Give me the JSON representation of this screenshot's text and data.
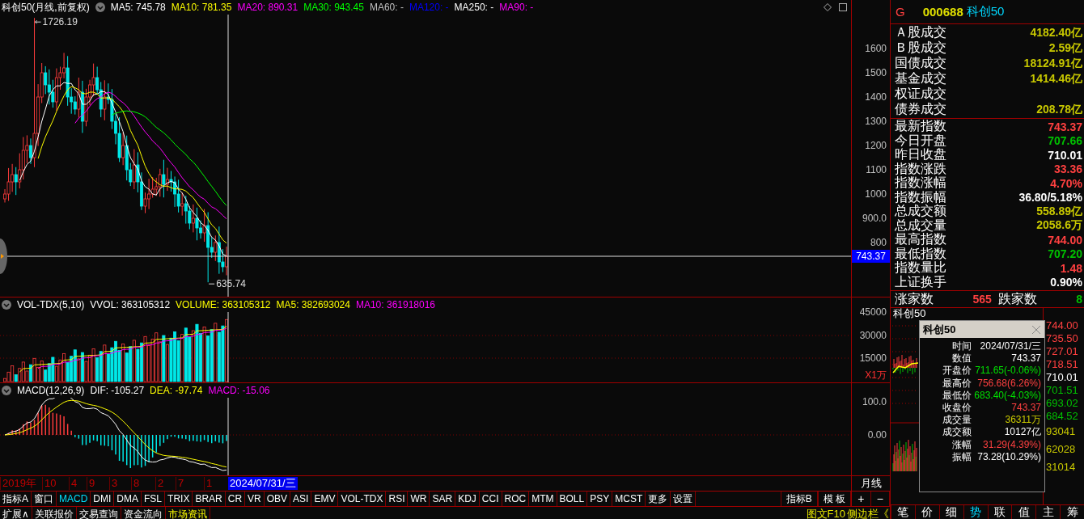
{
  "main_header": {
    "title": "科创50(月线,前复权)",
    "indicators": [
      {
        "label": "MA5: 745.78",
        "color": "#ffffff"
      },
      {
        "label": "MA10: 781.35",
        "color": "#ffff00"
      },
      {
        "label": "MA20: 890.31",
        "color": "#ff00ff"
      },
      {
        "label": "MA30: 943.45",
        "color": "#00ff00"
      },
      {
        "label": "MA60: -",
        "color": "#c0c0c0"
      },
      {
        "label": "MA120: -",
        "color": "#0000ff"
      },
      {
        "label": "MA250: -",
        "color": "#ffffff"
      },
      {
        "label": "MA90: -",
        "color": "#ff00ff"
      }
    ]
  },
  "price_axis": {
    "ticks": [
      "1600",
      "1500",
      "1400",
      "1300",
      "1200",
      "1100",
      "1000",
      "900.0",
      "800"
    ],
    "current": "743.37"
  },
  "price_marks": {
    "high": "1726.19",
    "low": "635.74"
  },
  "volume_panel": {
    "title": "VOL-TDX(5,10)",
    "indicators": [
      {
        "label": "VVOL: 363105312",
        "color": "#ffffff"
      },
      {
        "label": "VOLUME: 363105312",
        "color": "#ffff00"
      },
      {
        "label": "MA5: 382693024",
        "color": "#ffff00"
      },
      {
        "label": "MA10: 361918016",
        "color": "#ff00ff"
      }
    ],
    "ticks": [
      "45000",
      "30000",
      "15000"
    ],
    "unit": "X1万"
  },
  "macd_panel": {
    "title": "MACD(12,26,9)",
    "indicators": [
      {
        "label": "DIF: -105.27",
        "color": "#ffffff"
      },
      {
        "label": "DEA: -97.74",
        "color": "#ffff00"
      },
      {
        "label": "MACD: -15.06",
        "color": "#ff00ff"
      }
    ],
    "ticks": [
      "100.0",
      "0.00"
    ]
  },
  "date_axis": {
    "labels": [
      "2019年",
      "10",
      "4",
      "9",
      "3",
      "8",
      "2",
      "7",
      "1"
    ],
    "cursor": "2024/07/31/三",
    "period": "月线"
  },
  "indicator_tabs": [
    {
      "label": "指标A",
      "selected": false
    },
    {
      "label": "窗口",
      "selected": false
    },
    {
      "label": "MACD",
      "selected": true
    },
    {
      "label": "DMI",
      "selected": false
    },
    {
      "label": "DMA",
      "selected": false
    },
    {
      "label": "FSL",
      "selected": false
    },
    {
      "label": "TRIX",
      "selected": false
    },
    {
      "label": "BRAR",
      "selected": false
    },
    {
      "label": "CR",
      "selected": false
    },
    {
      "label": "VR",
      "selected": false
    },
    {
      "label": "OBV",
      "selected": false
    },
    {
      "label": "ASI",
      "selected": false
    },
    {
      "label": "EMV",
      "selected": false
    },
    {
      "label": "VOL-TDX",
      "selected": false
    },
    {
      "label": "RSI",
      "selected": false
    },
    {
      "label": "WR",
      "selected": false
    },
    {
      "label": "SAR",
      "selected": false
    },
    {
      "label": "KDJ",
      "selected": false
    },
    {
      "label": "CCI",
      "selected": false
    },
    {
      "label": "ROC",
      "selected": false
    },
    {
      "label": "MTM",
      "selected": false
    },
    {
      "label": "BOLL",
      "selected": false
    },
    {
      "label": "PSY",
      "selected": false
    },
    {
      "label": "MCST",
      "selected": false
    },
    {
      "label": "更多",
      "selected": false
    },
    {
      "label": "设置",
      "selected": false
    }
  ],
  "template_tabs": [
    "指标B",
    "模 板"
  ],
  "zoom_buttons": [
    "+",
    "−"
  ],
  "bottom_tabs": [
    {
      "label": "扩展∧",
      "highlighted": false
    },
    {
      "label": "关联报价",
      "highlighted": false
    },
    {
      "label": "交易查询",
      "highlighted": false
    },
    {
      "label": "资金流向",
      "highlighted": false
    },
    {
      "label": "市场资讯",
      "highlighted": true
    }
  ],
  "side_links": [
    "图文F10",
    "侧边栏《"
  ],
  "quote": {
    "flag": "G",
    "code": "000688",
    "name": "科创50",
    "turnover": [
      {
        "label": "Ａ股成交",
        "value": "4182.40亿",
        "color": "#c8c800"
      },
      {
        "label": "Ｂ股成交",
        "value": "2.59亿",
        "color": "#c8c800"
      },
      {
        "label": "国债成交",
        "value": "18124.91亿",
        "color": "#c8c800"
      },
      {
        "label": "基金成交",
        "value": "1414.46亿",
        "color": "#c8c800"
      },
      {
        "label": "权证成交"
      },
      {
        "label": "债券成交",
        "value": "208.78亿",
        "color": "#c8c800"
      }
    ],
    "stats": [
      {
        "label": "最新指数",
        "value": "743.37",
        "color": "#ff4040"
      },
      {
        "label": "今日开盘",
        "value": "707.66",
        "color": "#00c000"
      },
      {
        "label": "昨日收盘",
        "value": "710.01",
        "color": "#ffffff"
      },
      {
        "label": "指数涨跌",
        "value": "33.36",
        "color": "#ff4040"
      },
      {
        "label": "指数涨幅",
        "value": "4.70%",
        "color": "#ff4040"
      },
      {
        "label": "指数振幅",
        "value": "36.80/5.18%",
        "color": "#ffffff"
      },
      {
        "label": "总成交额",
        "value": "558.89亿",
        "color": "#c8c800"
      },
      {
        "label": "总成交量",
        "value": "2058.6万",
        "color": "#c8c800"
      },
      {
        "label": "最高指数",
        "value": "744.00",
        "color": "#ff4040"
      },
      {
        "label": "最低指数",
        "value": "707.20",
        "color": "#00c000"
      },
      {
        "label": "指数量比",
        "value": "1.48",
        "color": "#ff4040"
      },
      {
        "label": "上证换手",
        "value": "0.90%",
        "color": "#ffffff"
      }
    ],
    "advance_label": "涨家数",
    "advance": "565",
    "decline_label": "跌家数",
    "decline": "8"
  },
  "mini_chart": {
    "title": "科创50",
    "prices": [
      {
        "value": "744.00",
        "color": "#ff4040"
      },
      {
        "value": "735.50",
        "color": "#ff4040"
      },
      {
        "value": "727.01",
        "color": "#ff4040"
      },
      {
        "value": "718.51",
        "color": "#ff4040"
      },
      {
        "value": "710.01",
        "color": "#ffffff"
      },
      {
        "value": "701.51",
        "color": "#00c000"
      },
      {
        "value": "693.02",
        "color": "#00c000"
      },
      {
        "value": "684.52",
        "color": "#00c000"
      }
    ],
    "volumes": [
      "93041",
      "62028",
      "31014"
    ]
  },
  "tooltip": {
    "title": "科创50",
    "rows": [
      {
        "label": "时间",
        "value": "2024/07/31/三",
        "color": "#ffffff"
      },
      {
        "label": "数值",
        "value": "743.37",
        "color": "#ffffff"
      },
      {
        "label": "开盘价",
        "value": "711.65(-0.06%)",
        "color": "#00e000"
      },
      {
        "label": "最高价",
        "value": "756.68(6.26%)",
        "color": "#ff4040"
      },
      {
        "label": "最低价",
        "value": "683.40(-4.03%)",
        "color": "#00e000"
      },
      {
        "label": "收盘价",
        "value": "743.37",
        "color": "#ff4040"
      },
      {
        "label": "成交量",
        "value": "36311万",
        "color": "#c8c800"
      },
      {
        "label": "成交额",
        "value": "10127亿",
        "color": "#ffffff"
      },
      {
        "label": "涨幅",
        "value": "31.29(4.39%)",
        "color": "#ff4040"
      },
      {
        "label": "振幅",
        "value": "73.28(10.29%)",
        "color": "#ffffff"
      }
    ]
  },
  "side_tabs": [
    {
      "label": "笔",
      "selected": false
    },
    {
      "label": "价",
      "selected": false
    },
    {
      "label": "细",
      "selected": false
    },
    {
      "label": "势",
      "selected": true
    },
    {
      "label": "联",
      "selected": false
    },
    {
      "label": "值",
      "selected": false
    },
    {
      "label": "主",
      "selected": false
    },
    {
      "label": "筹",
      "selected": false
    }
  ]
}
